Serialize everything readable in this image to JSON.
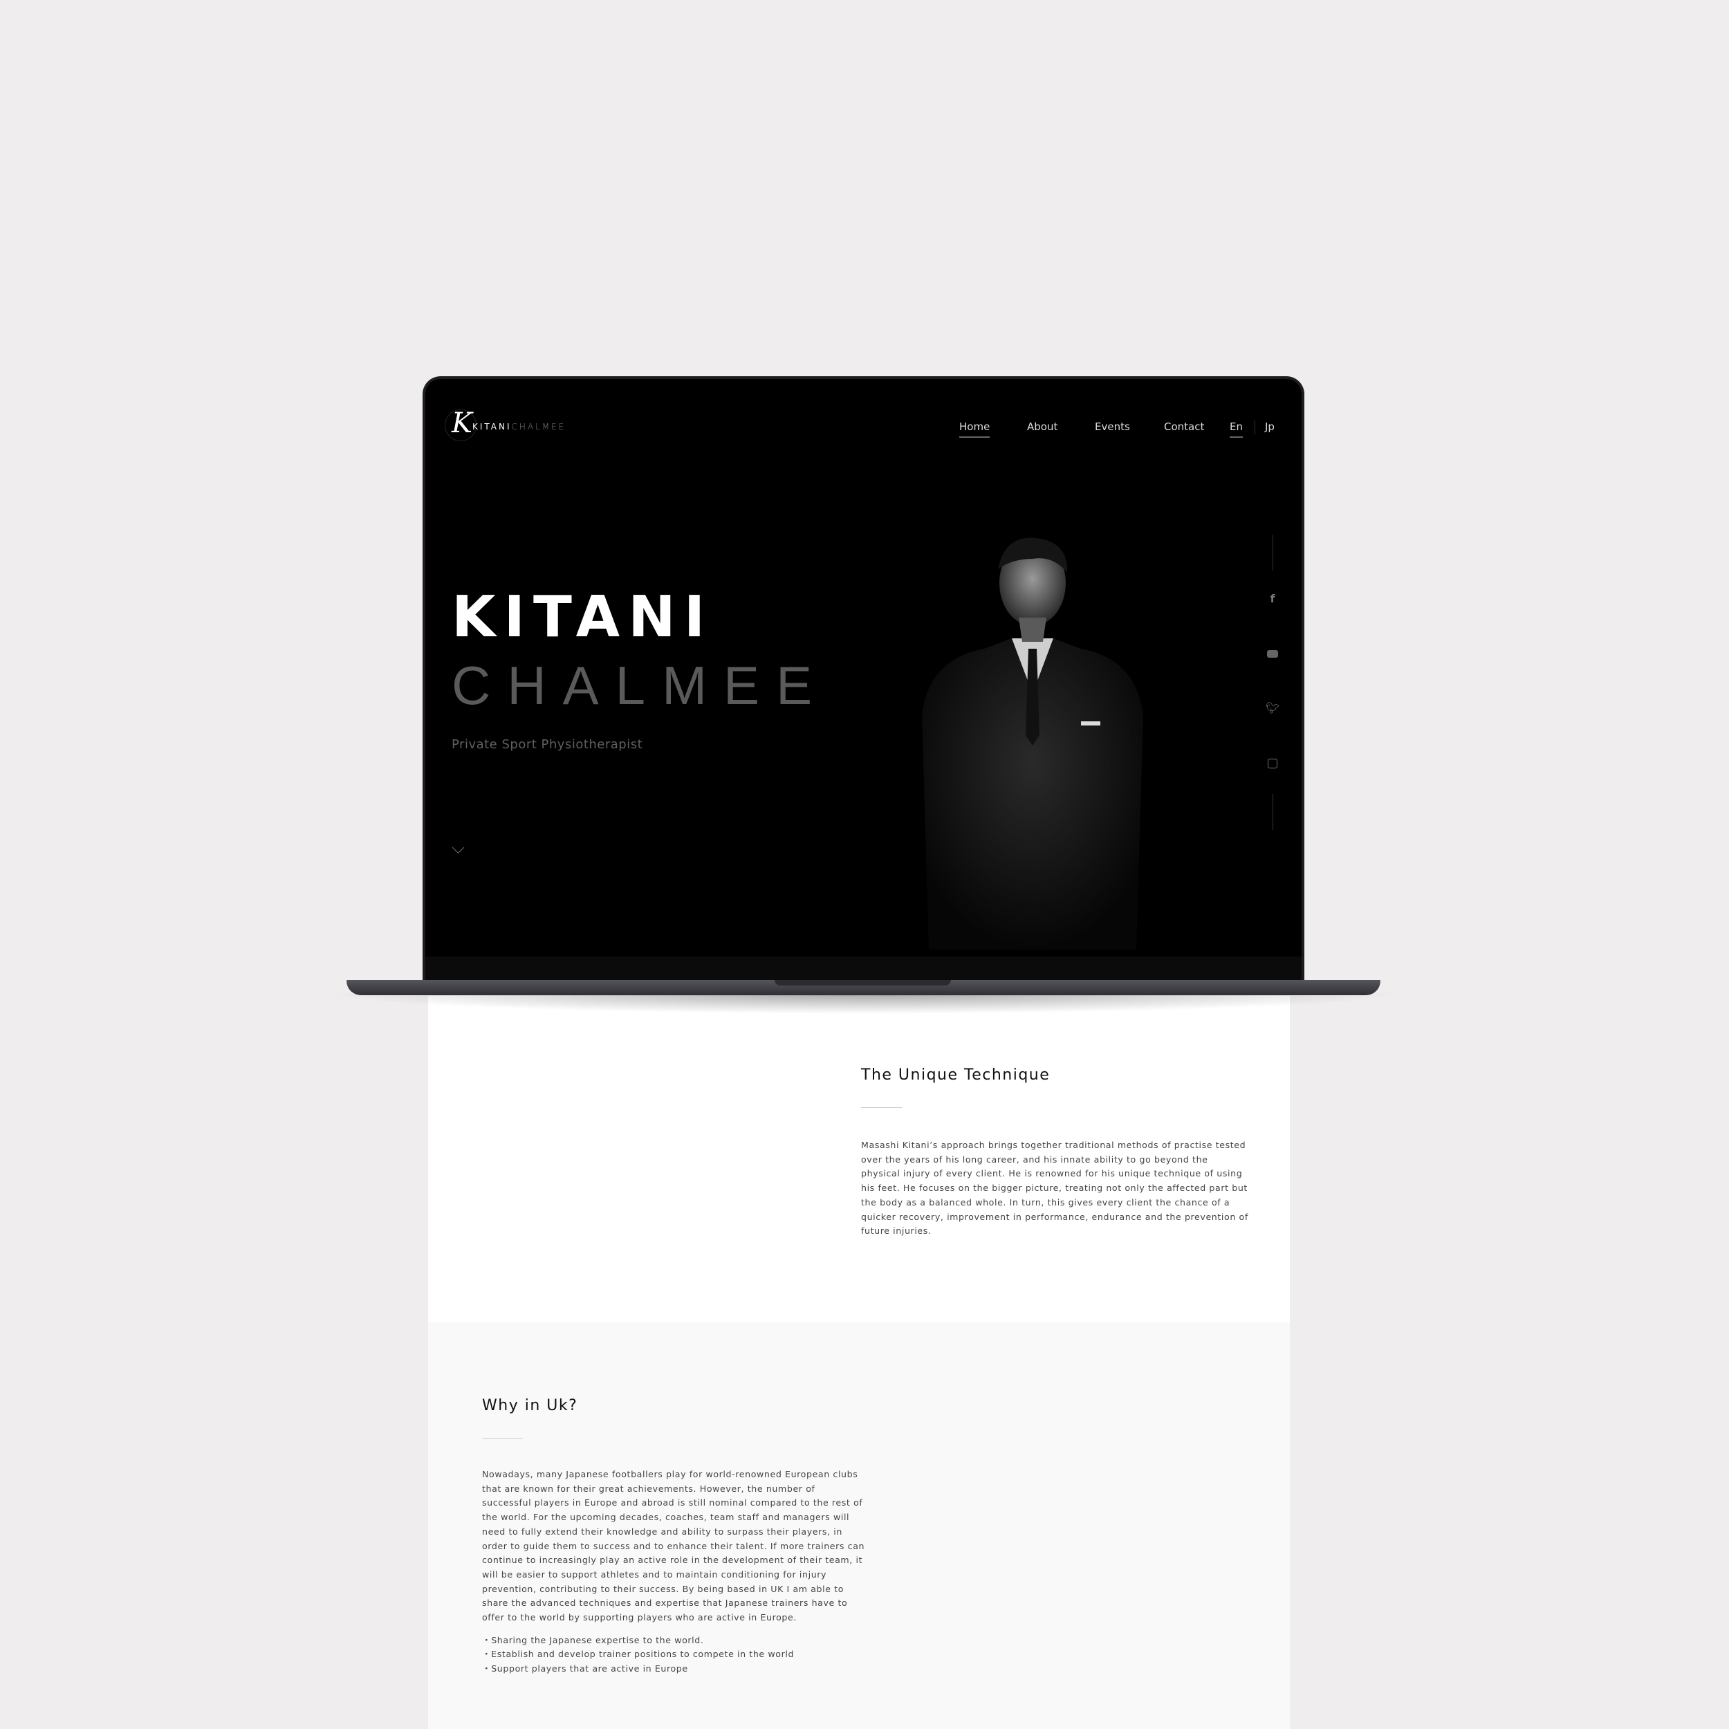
{
  "logo": {
    "mark": "K",
    "name_bold": "KITANI",
    "name_light": "CHALMEE"
  },
  "nav": {
    "items": [
      "Home",
      "About",
      "Events",
      "Contact"
    ],
    "active": "Home",
    "languages": [
      "En",
      "Jp"
    ],
    "active_language": "En"
  },
  "hero": {
    "title_line1": "KITANI",
    "title_line2": "CHALMEE",
    "tagline": "Private Sport Physiotherapist"
  },
  "social": [
    "facebook-icon",
    "youtube-icon",
    "twitter-icon",
    "instagram-icon"
  ],
  "technique": {
    "heading": "The Unique Technique",
    "body": "Masashi Kitani’s approach brings together traditional methods of practise tested over the years of his long career, and his innate ability to go beyond the physical injury of every client. He is renowned for his unique technique of using his feet. He focuses on the bigger picture, treating not only the affected part but the body as a balanced whole. In turn, this gives every client the chance of a quicker recovery, improvement in performance, endurance and the prevention of future injuries."
  },
  "why_uk": {
    "heading": "Why in Uk?",
    "body": "Nowadays, many Japanese footballers play for world-renowned European clubs that are known for their great achievements. However, the number of successful players in Europe and abroad is still nominal compared to the rest of the world. For the upcoming decades, coaches, team staff and managers will need to fully extend their knowledge and ability to surpass their players, in order to guide them to success and to enhance their talent. If more trainers can continue to increasingly play an active role in the development of their team, it will be easier to support athletes and to maintain conditioning for injury prevention, contributing to their success. By being based in UK I am able to share the advanced techniques and expertise that Japanese trainers have to offer to the world by supporting players who are active in Europe.",
    "bullets": [
      "Sharing the Japanese expertise to the world.",
      "Establish and develop trainer positions to compete in the world",
      "Support players that are active in Europe"
    ]
  },
  "colors": {
    "background": "#efedee",
    "hero": "#000000",
    "text": "#444444"
  }
}
